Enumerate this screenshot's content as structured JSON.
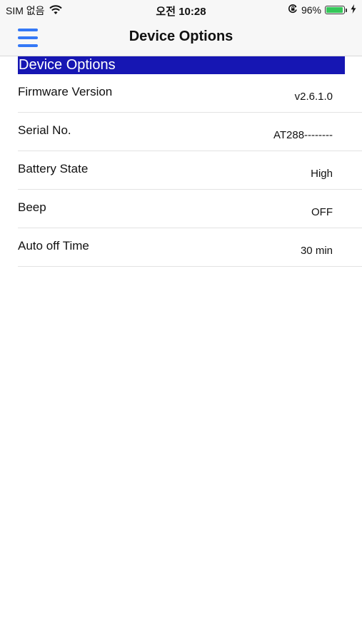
{
  "status_bar": {
    "carrier": "SIM 없음",
    "time": "오전 10:28",
    "battery_percent": "96%",
    "battery_level": 0.96,
    "icons": [
      "wifi-icon",
      "rotation-lock-icon",
      "battery-icon",
      "charging-icon"
    ]
  },
  "nav": {
    "title": "Device Options",
    "menu_icon": "hamburger-menu-icon"
  },
  "section": {
    "header": "Device Options",
    "rows": [
      {
        "label": "Firmware Version",
        "value": "v2.6.1.0"
      },
      {
        "label": "Serial No.",
        "value": "AT288--------"
      },
      {
        "label": "Battery State",
        "value": "High"
      },
      {
        "label": "Beep",
        "value": "OFF"
      },
      {
        "label": "Auto off Time",
        "value": "30 min"
      }
    ]
  },
  "colors": {
    "accent": "#3478f6",
    "section_header_bg": "#1616b3",
    "battery_green": "#34c759"
  }
}
